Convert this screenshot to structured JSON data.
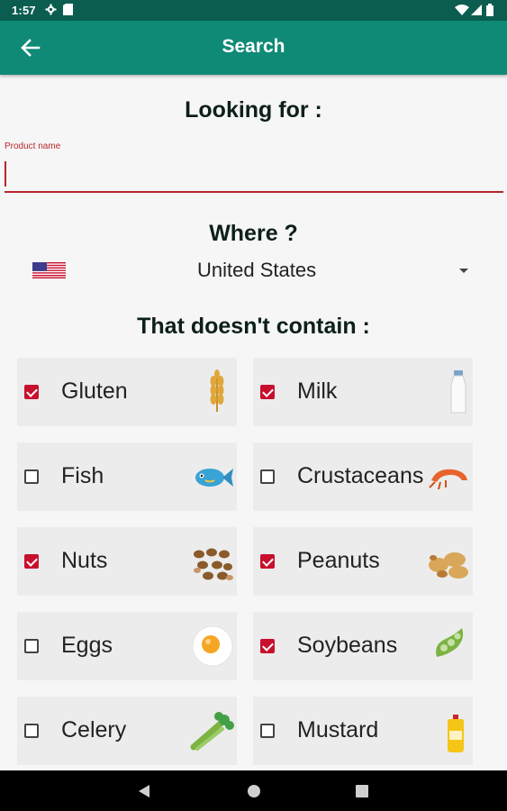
{
  "status_bar": {
    "time": "1:57",
    "left_icons": [
      "gear-icon",
      "sim-card-icon"
    ],
    "right_icons": [
      "wifi-icon",
      "cell-signal-icon",
      "battery-icon"
    ]
  },
  "app_bar": {
    "title": "Search",
    "back_icon": "arrow-left-icon"
  },
  "looking_for": {
    "heading": "Looking for :",
    "product_label": "Product name",
    "product_value": ""
  },
  "where": {
    "heading": "Where ?",
    "country": "United States",
    "flag_icon": "us-flag-icon"
  },
  "allergens": {
    "heading": "That doesn't contain :",
    "items": [
      {
        "label": "Gluten",
        "checked": true,
        "icon": "wheat-icon"
      },
      {
        "label": "Milk",
        "checked": true,
        "icon": "milk-bottle-icon"
      },
      {
        "label": "Fish",
        "checked": false,
        "icon": "fish-icon"
      },
      {
        "label": "Crustaceans",
        "checked": false,
        "icon": "shrimp-icon"
      },
      {
        "label": "Nuts",
        "checked": true,
        "icon": "nuts-icon"
      },
      {
        "label": "Peanuts",
        "checked": true,
        "icon": "peanuts-icon"
      },
      {
        "label": "Eggs",
        "checked": false,
        "icon": "egg-icon"
      },
      {
        "label": "Soybeans",
        "checked": true,
        "icon": "soybean-icon"
      },
      {
        "label": "Celery",
        "checked": false,
        "icon": "celery-icon"
      },
      {
        "label": "Mustard",
        "checked": false,
        "icon": "mustard-icon"
      }
    ]
  },
  "colors": {
    "status_bar": "#0b5d4f",
    "app_bar": "#0f8a76",
    "accent": "#b5262c",
    "checkbox_checked": "#c8102e"
  },
  "nav_bar": {
    "icons": [
      "back-triangle-icon",
      "home-circle-icon",
      "recents-square-icon"
    ]
  }
}
